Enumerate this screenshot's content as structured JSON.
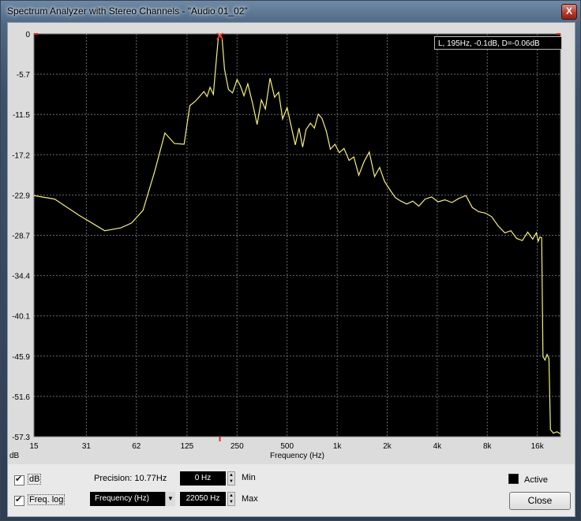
{
  "window": {
    "title": "Spectrum Analyzer with Stereo Channels - \"Audio 01_02\"",
    "close_glyph": "X"
  },
  "readout": "L, 195Hz, -0.1dB, D=-0.06dB",
  "chart_data": {
    "type": "line",
    "xlabel": "Frequency (Hz)",
    "ylabel": "dB",
    "x_scale": "log",
    "xlim": [
      15,
      22050
    ],
    "ylim": [
      -57.3,
      0
    ],
    "y_ticks": [
      "0",
      "-5.7",
      "-11.5",
      "-17.2",
      "-22.9",
      "-28.7",
      "-34.4",
      "-40.1",
      "-45.9",
      "-51.6",
      "-57.3"
    ],
    "x_ticks": [
      {
        "v": 15,
        "label": "15"
      },
      {
        "v": 31,
        "label": "31"
      },
      {
        "v": 62,
        "label": "62"
      },
      {
        "v": 125,
        "label": "125"
      },
      {
        "v": 250,
        "label": "250"
      },
      {
        "v": 500,
        "label": "500"
      },
      {
        "v": 1000,
        "label": "1k"
      },
      {
        "v": 2000,
        "label": "2k"
      },
      {
        "v": 4000,
        "label": "4k"
      },
      {
        "v": 8000,
        "label": "8k"
      },
      {
        "v": 16000,
        "label": "16k"
      }
    ],
    "series": [
      {
        "color": "#f5f07a",
        "points": [
          [
            15,
            -23.0
          ],
          [
            20,
            -23.5
          ],
          [
            28,
            -25.8
          ],
          [
            40,
            -28.0
          ],
          [
            50,
            -27.6
          ],
          [
            58,
            -26.9
          ],
          [
            68,
            -25.1
          ],
          [
            80,
            -19.5
          ],
          [
            92,
            -14.1
          ],
          [
            105,
            -15.6
          ],
          [
            120,
            -15.7
          ],
          [
            130,
            -10.2
          ],
          [
            140,
            -9.6
          ],
          [
            150,
            -8.8
          ],
          [
            158,
            -8.2
          ],
          [
            165,
            -8.9
          ],
          [
            172,
            -7.6
          ],
          [
            180,
            -8.6
          ],
          [
            188,
            -3.5
          ],
          [
            193,
            -0.5
          ],
          [
            197,
            -0.1
          ],
          [
            203,
            -0.6
          ],
          [
            210,
            -5.0
          ],
          [
            222,
            -7.9
          ],
          [
            235,
            -8.4
          ],
          [
            250,
            -6.5
          ],
          [
            262,
            -7.4
          ],
          [
            275,
            -8.8
          ],
          [
            290,
            -7.1
          ],
          [
            310,
            -9.9
          ],
          [
            330,
            -12.9
          ],
          [
            350,
            -9.4
          ],
          [
            370,
            -10.7
          ],
          [
            395,
            -6.3
          ],
          [
            420,
            -9.0
          ],
          [
            445,
            -8.3
          ],
          [
            470,
            -12.1
          ],
          [
            500,
            -10.5
          ],
          [
            530,
            -13.2
          ],
          [
            560,
            -15.8
          ],
          [
            590,
            -13.4
          ],
          [
            620,
            -16.1
          ],
          [
            650,
            -13.6
          ],
          [
            690,
            -12.7
          ],
          [
            730,
            -13.4
          ],
          [
            770,
            -11.4
          ],
          [
            810,
            -12.0
          ],
          [
            860,
            -13.8
          ],
          [
            910,
            -16.4
          ],
          [
            970,
            -15.7
          ],
          [
            1030,
            -16.9
          ],
          [
            1100,
            -16.3
          ],
          [
            1180,
            -18.0
          ],
          [
            1260,
            -17.5
          ],
          [
            1350,
            -20.1
          ],
          [
            1450,
            -18.2
          ],
          [
            1560,
            -16.8
          ],
          [
            1680,
            -20.3
          ],
          [
            1800,
            -19.0
          ],
          [
            1930,
            -21.0
          ],
          [
            2080,
            -22.2
          ],
          [
            2240,
            -23.3
          ],
          [
            2420,
            -23.8
          ],
          [
            2620,
            -24.2
          ],
          [
            2850,
            -23.8
          ],
          [
            3100,
            -24.5
          ],
          [
            3380,
            -23.5
          ],
          [
            3700,
            -23.2
          ],
          [
            4050,
            -23.9
          ],
          [
            4450,
            -23.6
          ],
          [
            4900,
            -24.0
          ],
          [
            5400,
            -23.4
          ],
          [
            5950,
            -23.0
          ],
          [
            6500,
            -24.7
          ],
          [
            7100,
            -25.3
          ],
          [
            7800,
            -25.5
          ],
          [
            8500,
            -26.0
          ],
          [
            9300,
            -27.3
          ],
          [
            10200,
            -28.3
          ],
          [
            11100,
            -28.0
          ],
          [
            12000,
            -29.1
          ],
          [
            13000,
            -29.4
          ],
          [
            14000,
            -28.2
          ],
          [
            15000,
            -29.2
          ],
          [
            15800,
            -28.3
          ],
          [
            16200,
            -29.5
          ],
          [
            16600,
            -28.9
          ],
          [
            17000,
            -29.0
          ],
          [
            17300,
            -45.9
          ],
          [
            17800,
            -46.4
          ],
          [
            18300,
            -45.6
          ],
          [
            18800,
            -46.2
          ],
          [
            19200,
            -56.3
          ],
          [
            20000,
            -56.8
          ],
          [
            21000,
            -56.6
          ],
          [
            22050,
            -56.9
          ]
        ]
      }
    ]
  },
  "controls": {
    "db_label": "dB",
    "freqlog_label": "Freq. log",
    "precision_label": "Precision: 10.77Hz",
    "min_value": "0 Hz",
    "min_label": "Min",
    "max_value": "22050 Hz",
    "max_label": "Max",
    "freq_select": "Frequency (Hz)",
    "active_label": "Active",
    "close_label": "Close"
  }
}
